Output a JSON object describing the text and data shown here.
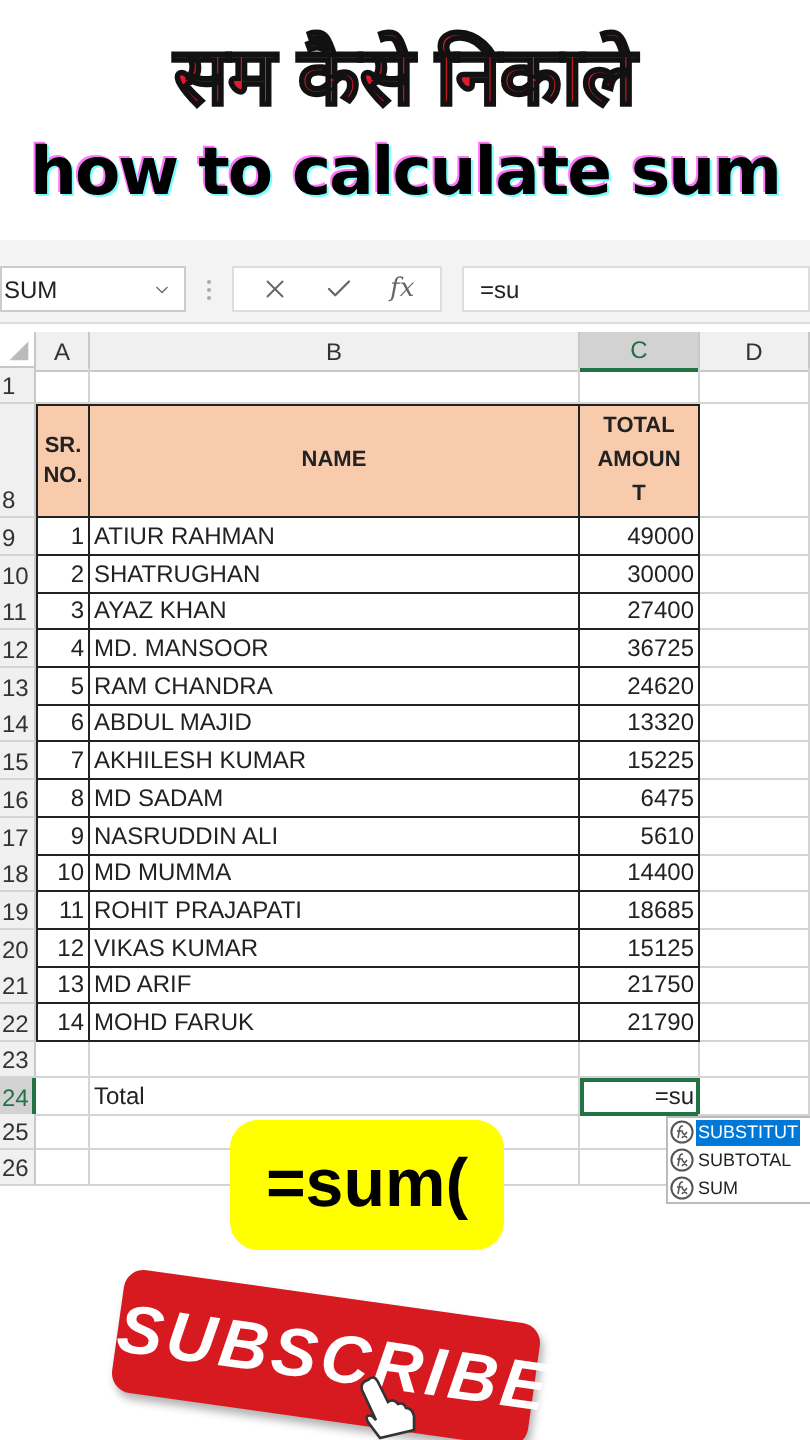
{
  "titles": {
    "hindi": "सम कैसे निकाले",
    "english": "how to calculate sum"
  },
  "formula_bar": {
    "name_box": "SUM",
    "fx": "fx",
    "formula": "=su"
  },
  "columns": [
    {
      "label": "A",
      "selected": false
    },
    {
      "label": "B",
      "selected": false
    },
    {
      "label": "C",
      "selected": true
    },
    {
      "label": "D",
      "selected": false
    }
  ],
  "rows": [
    {
      "number": "1",
      "kind": "blank",
      "selected": false
    },
    {
      "number": "8",
      "kind": "header",
      "selected": false,
      "cells": [
        "SR. NO.",
        "NAME",
        "TOTAL AMOUNT"
      ]
    },
    {
      "number": "9",
      "kind": "data",
      "selected": false,
      "cells": [
        "1",
        "ATIUR RAHMAN",
        "49000"
      ]
    },
    {
      "number": "10",
      "kind": "data",
      "selected": false,
      "cells": [
        "2",
        "SHATRUGHAN",
        "30000"
      ]
    },
    {
      "number": "11",
      "kind": "data",
      "selected": false,
      "cells": [
        "3",
        "AYAZ KHAN",
        "27400"
      ]
    },
    {
      "number": "12",
      "kind": "data",
      "selected": false,
      "cells": [
        "4",
        "MD. MANSOOR",
        "36725"
      ]
    },
    {
      "number": "13",
      "kind": "data",
      "selected": false,
      "cells": [
        "5",
        "RAM CHANDRA",
        "24620"
      ]
    },
    {
      "number": "14",
      "kind": "data",
      "selected": false,
      "cells": [
        "6",
        "ABDUL MAJID",
        "13320"
      ]
    },
    {
      "number": "15",
      "kind": "data",
      "selected": false,
      "cells": [
        "7",
        "AKHILESH KUMAR",
        "15225"
      ]
    },
    {
      "number": "16",
      "kind": "data",
      "selected": false,
      "cells": [
        "8",
        "MD SADAM",
        "6475"
      ]
    },
    {
      "number": "17",
      "kind": "data",
      "selected": false,
      "cells": [
        "9",
        "NASRUDDIN ALI",
        "5610"
      ]
    },
    {
      "number": "18",
      "kind": "data",
      "selected": false,
      "cells": [
        "10",
        "MD MUMMA",
        "14400"
      ]
    },
    {
      "number": "19",
      "kind": "data",
      "selected": false,
      "cells": [
        "11",
        "ROHIT PRAJAPATI",
        "18685"
      ]
    },
    {
      "number": "20",
      "kind": "data",
      "selected": false,
      "cells": [
        "12",
        "VIKAS KUMAR",
        "15125"
      ]
    },
    {
      "number": "21",
      "kind": "data",
      "selected": false,
      "cells": [
        "13",
        "MD ARIF",
        "21750"
      ]
    },
    {
      "number": "22",
      "kind": "data",
      "selected": false,
      "cells": [
        "14",
        "MOHD FARUK",
        "21790"
      ]
    },
    {
      "number": "23",
      "kind": "blank",
      "selected": false
    },
    {
      "number": "24",
      "kind": "total",
      "selected": true,
      "cells": [
        "Total",
        "=su"
      ]
    },
    {
      "number": "25",
      "kind": "blank",
      "selected": false
    },
    {
      "number": "26",
      "kind": "blank",
      "selected": false
    }
  ],
  "autocomplete": [
    {
      "label": "SUBSTITUT",
      "selected": true
    },
    {
      "label": "SUBTOTAL",
      "selected": false
    },
    {
      "label": "SUM",
      "selected": false
    }
  ],
  "hint": "=sum(",
  "subscribe": "SUBSCRIBE"
}
